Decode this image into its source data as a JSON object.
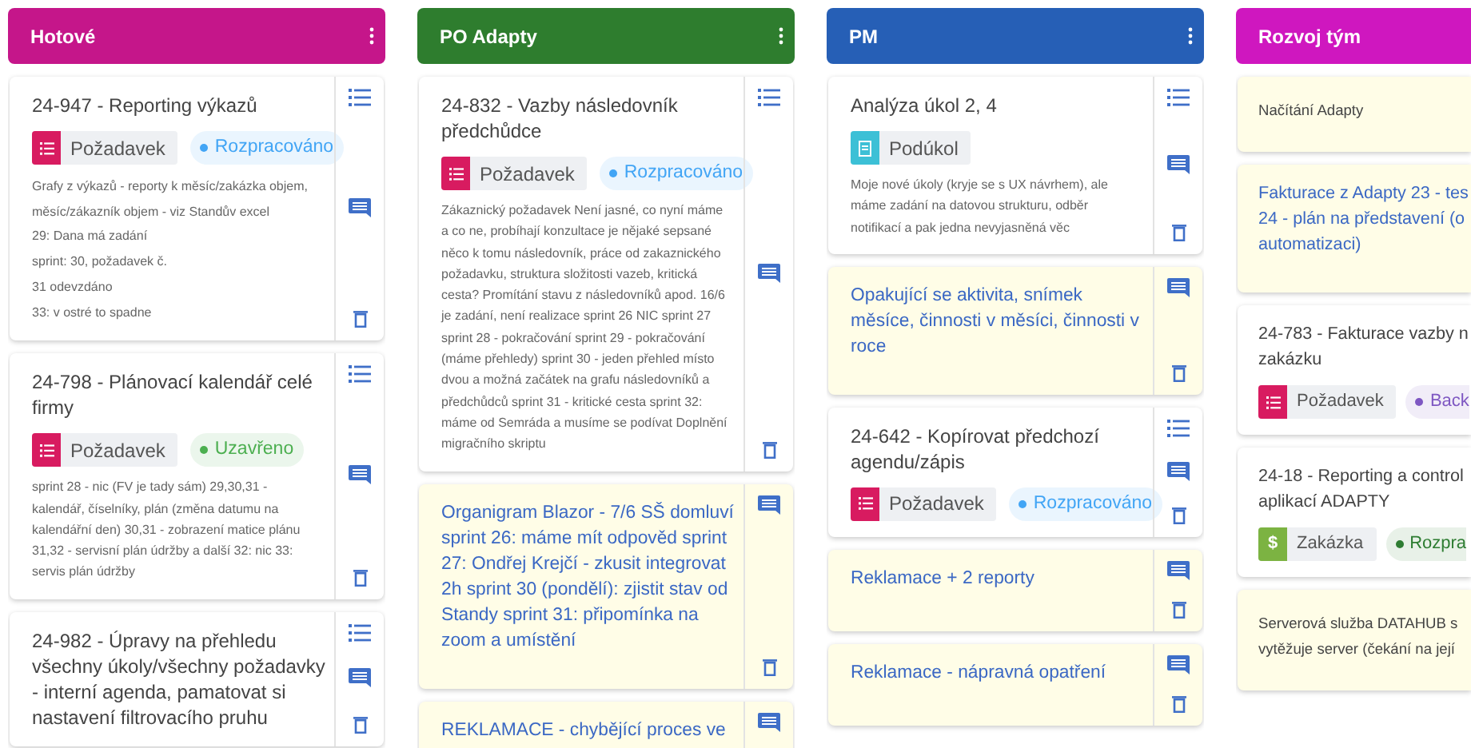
{
  "columns": [
    {
      "title": "Hotové",
      "color": "#c5168a",
      "cards": [
        {
          "kind": "task",
          "title": "24-947 - Reporting výkazů",
          "type": {
            "kind": "request",
            "label": "Požadavek",
            "color": "#d81b60"
          },
          "status": {
            "label": "Rozpracováno",
            "color": "#42a5f5"
          },
          "description": [
            "Grafy z výkazů - reporty k měsíc/zakázka objem, měsíc/zákazník objem - viz Standův excel",
            "29: Dana má zadání",
            "sprint: 30, požadavek č.",
            "31 odevzdáno",
            "33: v ostré to spadne"
          ]
        },
        {
          "kind": "task",
          "title": "24-798 - Plánovací kalendář celé firmy",
          "type": {
            "kind": "request",
            "label": "Požadavek",
            "color": "#d81b60"
          },
          "status": {
            "label": "Uzavřeno",
            "color": "#4caf50"
          },
          "description": [
            "sprint 28 - nic (FV je tady sám) 29,30,31 - kalendář, číselníky, plán (změna datumu na kalendářní den) 30,31 - zobrazení matice plánu 31,32 - servisní plán údržby a další 32: nic 33: servis plán údržby"
          ]
        },
        {
          "kind": "task",
          "title": "24-982 - Úpravy na přehledu všechny úkoly/všechny požadavky - interní agenda, pamatovat si nastavení filtrovacího pruhu"
        }
      ]
    },
    {
      "title": "PO Adapty",
      "color": "#2e7d2e",
      "cards": [
        {
          "kind": "task",
          "title": "24-832 - Vazby následovník předchůdce",
          "type": {
            "kind": "request",
            "label": "Požadavek",
            "color": "#d81b60"
          },
          "status": {
            "label": "Rozpracováno",
            "color": "#42a5f5"
          },
          "description": [
            "Zákaznický požadavek Není jasné, co nyní máme a co ne, probíhají konzultace je nějaké sepsané něco k tomu následovník, práce od zakaznického požadavku, struktura složitosti vazeb, kritická cesta? Promítání stavu z následovníků apod. 16/6 je zadání, není realizace sprint 26 NIC sprint 27 sprint 28 - pokračování sprint 29 - pokračování (máme přehledy) sprint 30 - jeden přehled místo dvou a možná začátek na grafu následovníků a předchůdců sprint 31 - kritické cesta sprint 32: máme od Semráda a musíme se podívat Doplnění migračního skriptu"
          ]
        },
        {
          "kind": "note",
          "title": "Organigram Blazor - 7/6 SŠ domluví sprint 26: máme mít odpověd sprint 27: Ondřej Krejčí - zkusit integrovat 2h sprint 30 (pondělí): zjistit stav od Standy sprint 31: připomínka na zoom a umístění"
        },
        {
          "kind": "note",
          "title": "REKLAMACE - chybějící proces ve"
        }
      ]
    },
    {
      "title": "PM",
      "color": "#265fb6",
      "cards": [
        {
          "kind": "task",
          "title": "Analýza úkol 2, 4",
          "type": {
            "kind": "subtask",
            "label": "Podúkol",
            "color": "#3cc0d6"
          },
          "description": [
            "Moje nové úkoly (kryje se s UX návrhem), ale máme zadání na datovou strukturu, odběr notifikací a pak jedna nevyjasněná věc"
          ]
        },
        {
          "kind": "note",
          "title": "Opakující se aktivita, snímek měsíce, činnosti v měsíci, činnosti v roce"
        },
        {
          "kind": "task",
          "title": "24-642 - Kopírovat předchozí agendu/zápis",
          "type": {
            "kind": "request",
            "label": "Požadavek",
            "color": "#d81b60"
          },
          "status": {
            "label": "Rozpracováno",
            "color": "#42a5f5"
          }
        },
        {
          "kind": "note",
          "title": "Reklamace + 2 reporty"
        },
        {
          "kind": "note",
          "title": "Reklamace - nápravná opatření"
        }
      ]
    },
    {
      "title": "Rozvoj tým",
      "color": "#cf17bf",
      "cards": [
        {
          "kind": "memo",
          "title_lines": [
            "Načítání Adapty"
          ]
        },
        {
          "kind": "note",
          "title_lines": [
            "Fakturace z Adapty 23 - tes",
            "24 - plán na představení (o",
            "automatizaci)"
          ]
        },
        {
          "kind": "task",
          "title_lines": [
            "24-783 - Fakturace vazby n",
            "zakázku"
          ],
          "type": {
            "kind": "request",
            "label": "Požadavek",
            "color": "#d81b60"
          },
          "status": {
            "label": "Back",
            "color": "#7e57c2"
          }
        },
        {
          "kind": "task",
          "title_lines": [
            "24-18 - Reporting a control",
            "aplikací ADAPTY"
          ],
          "type": {
            "kind": "contract",
            "label": "Zakázka",
            "color": "#7cb342",
            "glyph": "$"
          },
          "status": {
            "label": "Rozpra",
            "color": "#2e7d32"
          }
        },
        {
          "kind": "memo",
          "title_lines": [
            "Serverová služba DATAHUB s",
            "vytěžuje server (čekání na její"
          ]
        }
      ]
    }
  ]
}
